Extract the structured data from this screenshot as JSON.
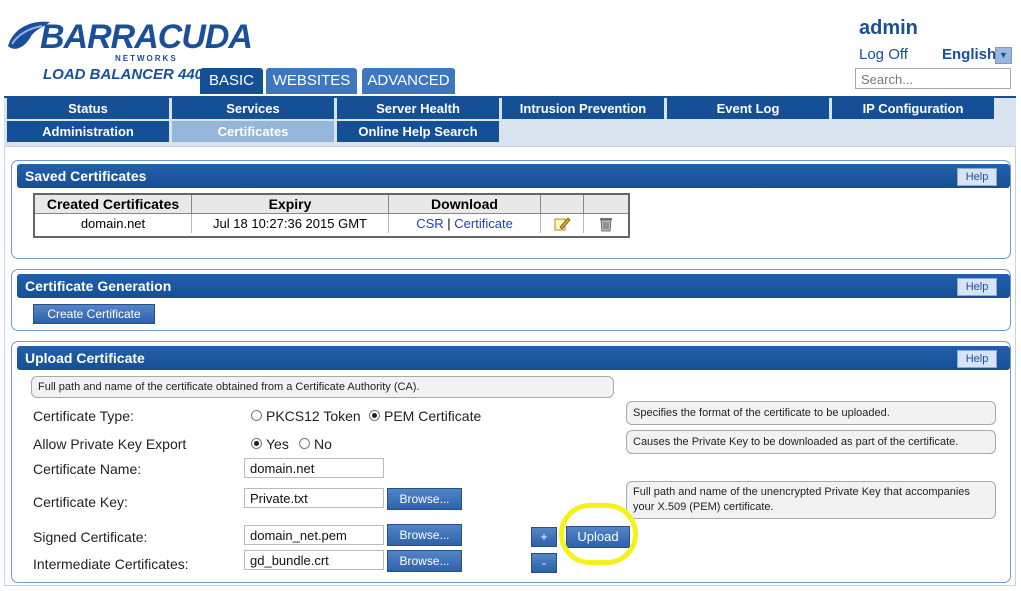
{
  "brand": {
    "logo": "BARRACUDA",
    "networks": "NETWORKS",
    "product": "LOAD BALANCER 440"
  },
  "tabs": [
    {
      "label": "BASIC"
    },
    {
      "label": "WEBSITES"
    },
    {
      "label": "ADVANCED"
    }
  ],
  "user": {
    "name": "admin",
    "logoff": "Log Off",
    "language": "English",
    "search_placeholder": "Search..."
  },
  "nav": {
    "row1": [
      "Status",
      "Services",
      "Server Health",
      "Intrusion Prevention",
      "Event Log",
      "IP Configuration"
    ],
    "row2": [
      "Administration",
      "Certificates",
      "Online Help Search"
    ]
  },
  "saved": {
    "title": "Saved Certificates",
    "help": "Help",
    "headers": [
      "Created Certificates",
      "Expiry",
      "Download"
    ],
    "row": {
      "name": "domain.net",
      "expiry": "Jul 18 10:27:36 2015 GMT",
      "csr": "CSR",
      "sep": "|",
      "cert": "Certificate"
    }
  },
  "generation": {
    "title": "Certificate Generation",
    "help": "Help",
    "button": "Create Certificate"
  },
  "upload": {
    "title": "Upload Certificate",
    "help": "Help",
    "intro": "Full path and name of the certificate obtained from a Certificate Authority (CA).",
    "type_label": "Certificate Type:",
    "type_opt1": "PKCS12 Token",
    "type_opt2": "PEM Certificate",
    "type_tip": "Specifies the format of the certificate to be uploaded.",
    "export_label": "Allow Private Key Export",
    "export_yes": "Yes",
    "export_no": "No",
    "export_tip": "Causes the Private Key to be downloaded as part of the certificate.",
    "name_label": "Certificate Name:",
    "name_value": "domain.net",
    "key_label": "Certificate Key:",
    "key_value": "Private.txt",
    "key_tip": "Full path and name of the unencrypted Private Key that accompanies your X.509 (PEM) certificate.",
    "signed_label": "Signed Certificate:",
    "signed_value": "domain_net.pem",
    "inter_label": "Intermediate Certificates:",
    "inter_value": "gd_bundle.crt",
    "browse": "Browse...",
    "plus": "+",
    "minus": "-",
    "upload_btn": "Upload"
  }
}
